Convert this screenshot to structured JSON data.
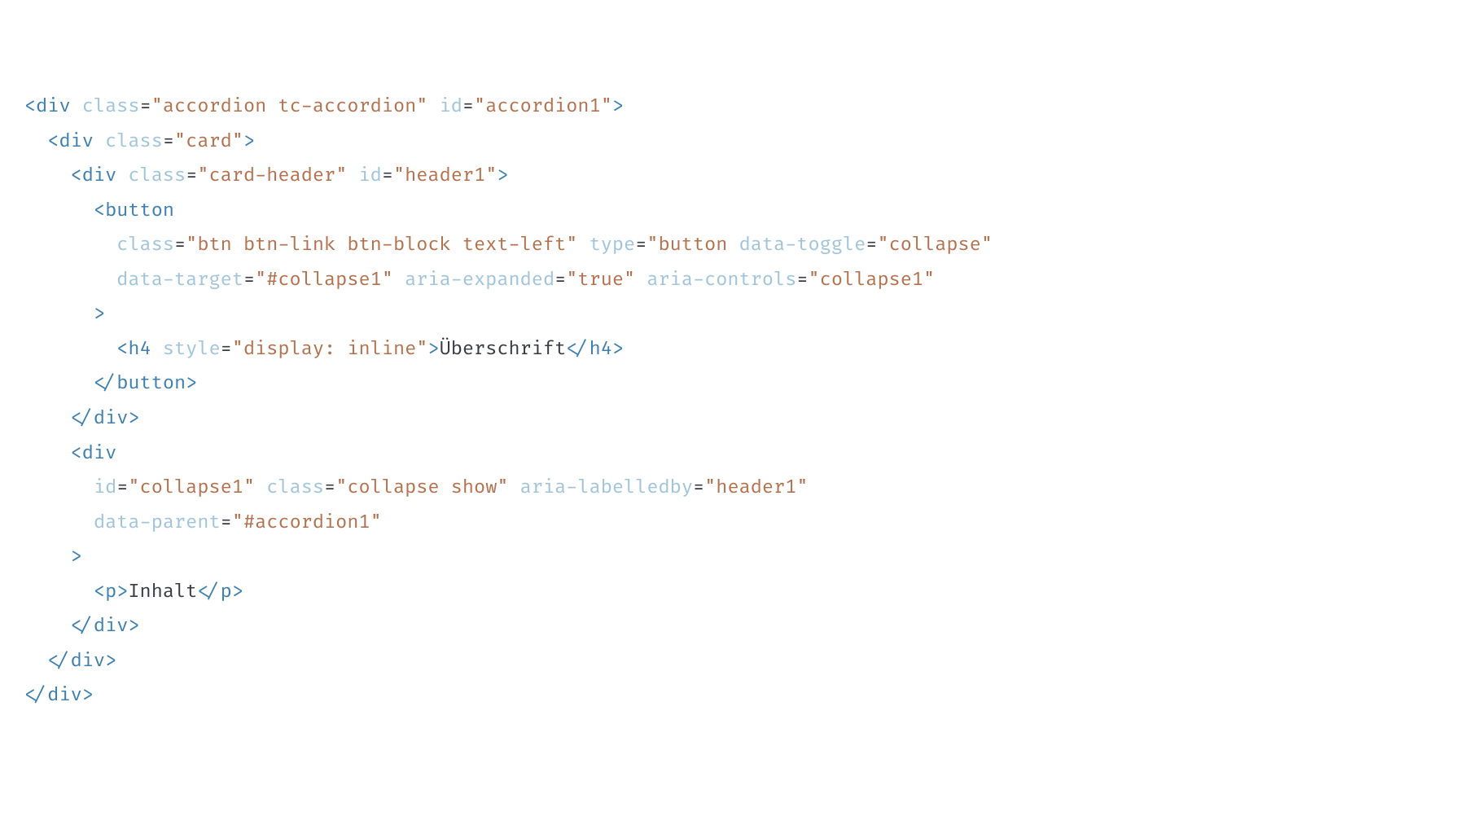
{
  "lines": {
    "l1": {
      "open": "<div",
      "a1n": "class",
      "a1v": "\"accordion tc-accordion\"",
      "a2n": "id",
      "a2v": "\"accordion1\"",
      "close": ">"
    },
    "l2": {
      "open": "<div",
      "a1n": "class",
      "a1v": "\"card\"",
      "close": ">"
    },
    "l3": {
      "open": "<div",
      "a1n": "class",
      "a1v": "\"card-header\"",
      "a2n": "id",
      "a2v": "\"header1\"",
      "close": ">"
    },
    "l4": {
      "open": "<button"
    },
    "l5": {
      "a1n": "class",
      "a1v": "\"btn btn-link btn-block text-left\"",
      "a2n": "type",
      "a2v1": "\"button",
      "a2dn": "data-toggle",
      "a2v2": "\"collapse\""
    },
    "l6": {
      "a1n": "data-target",
      "a1v": "\"#collapse1\"",
      "a2n": "aria-expanded",
      "a2q1": "\"",
      "a2kw": "true",
      "a2q2": "\"",
      "a3n": "aria-controls",
      "a3v": "\"collapse1\""
    },
    "l7": {
      "close": ">"
    },
    "l8": {
      "open": "<h4",
      "a1n": "style",
      "a1v": "\"display: inline\"",
      "mid": ">",
      "text": "Überschrift",
      "endopen": "</h4",
      "endclose": ">"
    },
    "l9": {
      "open": "</button",
      "close": ">"
    },
    "l10": {
      "open": "</div",
      "close": ">"
    },
    "l11": {
      "open": "<div"
    },
    "l12": {
      "a1n": "id",
      "a1v": "\"collapse1\"",
      "a2n": "class",
      "a2v": "\"collapse show\"",
      "a3n": "aria-labelledby",
      "a3v": "\"header1\""
    },
    "l13": {
      "a1n": "data-parent",
      "a1v": "\"#accordion1\""
    },
    "l14": {
      "close": ">"
    },
    "l15": {
      "open": "<p",
      "mid": ">",
      "text": "Inhalt",
      "endopen": "</p",
      "endclose": ">"
    },
    "l16": {
      "open": "</div",
      "close": ">"
    },
    "l17": {
      "open": "</div",
      "close": ">"
    },
    "l18": {
      "open": "</div",
      "close": ">"
    }
  }
}
